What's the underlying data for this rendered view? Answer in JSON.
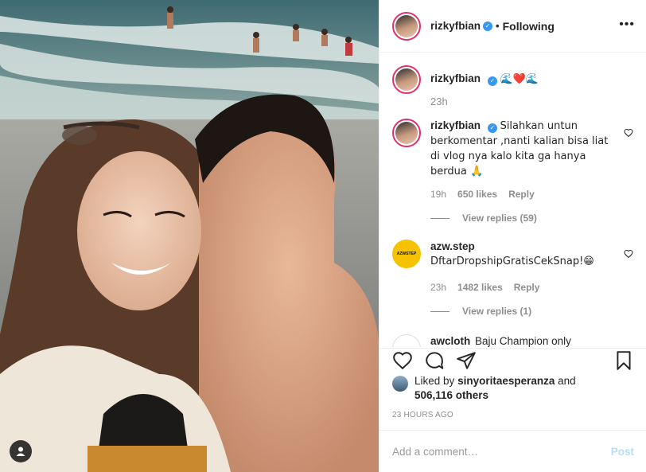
{
  "post": {
    "author": "rizkyfbian",
    "follow_status": "Following",
    "separator": "•",
    "more": "•••"
  },
  "caption": {
    "username": "rizkyfbian",
    "text": "🌊❤️🌊",
    "time": "23h"
  },
  "comments": [
    {
      "username": "rizkyfbian",
      "text": "Silahkan untun berkomentar ,nanti kalian bisa liat di vlog nya kalo kita ga hanya berdua 🙏",
      "time": "19h",
      "likes": "650 likes",
      "reply": "Reply",
      "view_replies": "View replies (59)"
    },
    {
      "username": "azw.step",
      "avatar_text": "AZWSTEP",
      "text": "DftarDropshipGratisCekSnap!😁",
      "time": "23h",
      "likes": "1482 likes",
      "reply": "Reply",
      "view_replies": "View replies (1)"
    },
    {
      "username": "awcloth",
      "text": "Baju Champion only"
    }
  ],
  "likes": {
    "prefix": "Liked by",
    "user": "sinyoritaesperanza",
    "and": "and",
    "others": "506,116 others"
  },
  "posted_time": "23 HOURS AGO",
  "add_comment": {
    "placeholder": "Add a comment…",
    "post_label": "Post"
  },
  "colors": {
    "verified": "#3897f0",
    "story_ring": "#e1306c",
    "post_button": "#b2dffc"
  }
}
